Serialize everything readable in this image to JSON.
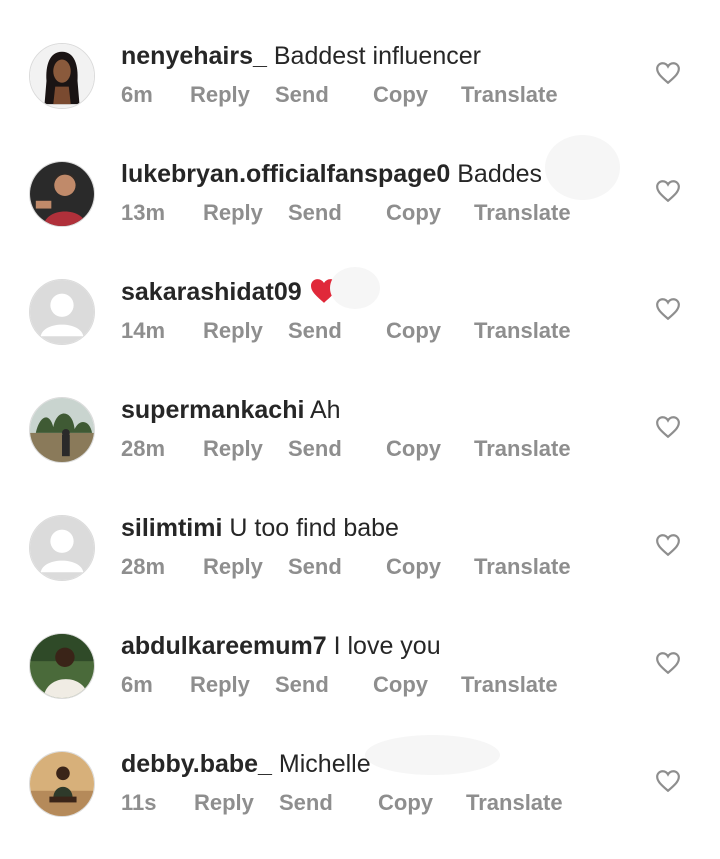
{
  "comments": [
    {
      "username": "nenyehairs_",
      "text": "Baddest influencer",
      "time": "6m",
      "reply": "Reply",
      "send": "Send",
      "copy": "Copy",
      "translate": "Translate",
      "avatar": "woman-long-hair-avatar"
    },
    {
      "username": "lukebryan.officialfanspage0",
      "text": "Baddest",
      "time": "13m",
      "reply": "Reply",
      "send": "Send",
      "copy": "Copy",
      "translate": "Translate",
      "avatar": "man-red-shirt-avatar"
    },
    {
      "username": "sakarashidat09",
      "text": "",
      "emoji": "red-heart-emoji",
      "time": "14m",
      "reply": "Reply",
      "send": "Send",
      "copy": "Copy",
      "translate": "Translate",
      "avatar": "default-avatar"
    },
    {
      "username": "supermankachi",
      "text": "Ah",
      "time": "28m",
      "reply": "Reply",
      "send": "Send",
      "copy": "Copy",
      "translate": "Translate",
      "avatar": "outdoor-person-avatar"
    },
    {
      "username": "silimtimi",
      "text": "U too find babe",
      "time": "28m",
      "reply": "Reply",
      "send": "Send",
      "copy": "Copy",
      "translate": "Translate",
      "avatar": "default-avatar"
    },
    {
      "username": "abdulkareemum7",
      "text": "I love you",
      "time": "6m",
      "reply": "Reply",
      "send": "Send",
      "copy": "Copy",
      "translate": "Translate",
      "avatar": "man-white-shirt-avatar"
    },
    {
      "username": "debby.babe_",
      "text": "Michelle",
      "time": "11s",
      "reply": "Reply",
      "send": "Send",
      "copy": "Copy",
      "translate": "Translate",
      "avatar": "woman-sitting-avatar"
    }
  ],
  "colors": {
    "text": "#262626",
    "meta": "#8e8e8e",
    "heart_outline": "#8e8e8e",
    "emoji_heart": "#e0293a"
  }
}
